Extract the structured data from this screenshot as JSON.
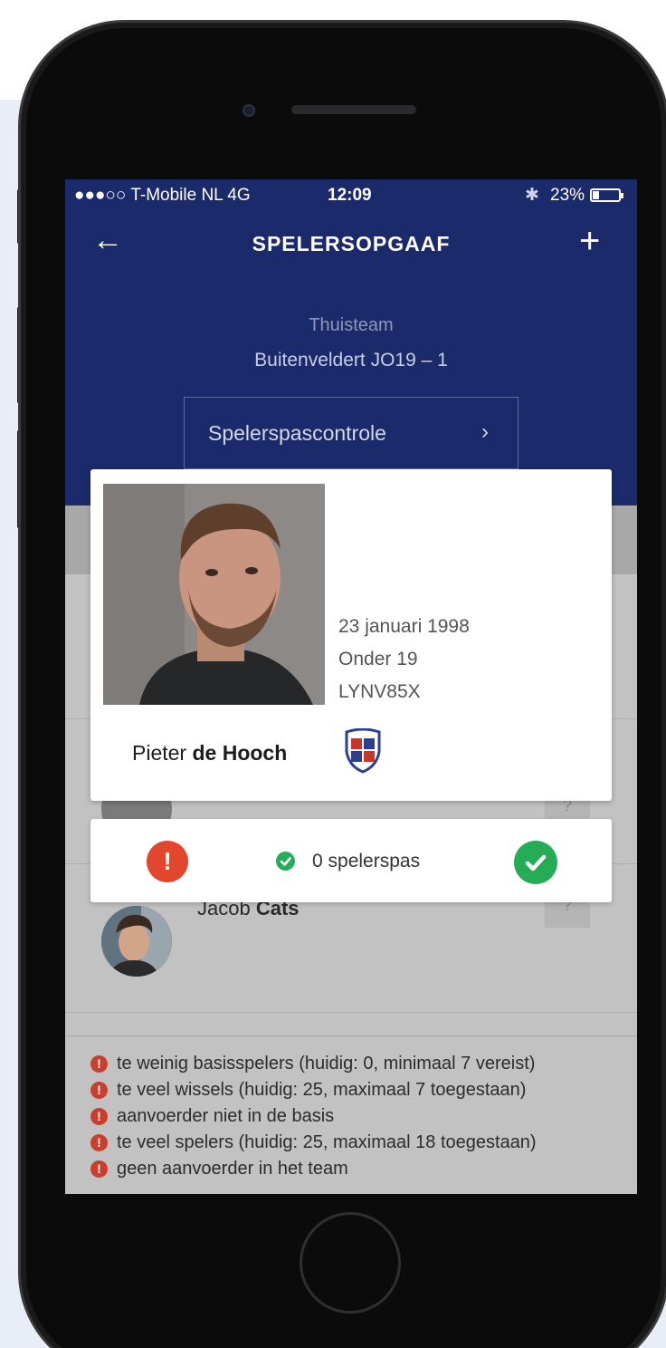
{
  "statusbar": {
    "carrier": "●●●○○ T-Mobile NL  4G",
    "time": "12:09",
    "bluetooth_icon": "bluetooth-icon",
    "battery_percent": "23%",
    "battery_level": 0.23
  },
  "navbar": {
    "back_glyph": "←",
    "title": "SPELERSOPGAAF",
    "add_glyph": "+"
  },
  "header": {
    "team_label": "Thuisteam",
    "team_name": "Buitenveldert JO19 – 1",
    "pass_check_button": "Spelerspascontrole",
    "pass_check_chevron": "›"
  },
  "player_card": {
    "date_of_birth": "23 januari 1998",
    "category": "Onder 19",
    "code": "LYNV85X",
    "first_name": "Pieter ",
    "last_name": "de Hooch",
    "club_logo": "club-crest"
  },
  "pass_status": {
    "warning_glyph": "!",
    "label": "0 spelerspas"
  },
  "players": [
    {
      "first_name": "Jacob ",
      "last_name": "Cats",
      "status": "?"
    }
  ],
  "errors": [
    "te weinig basisspelers (huidig: 0, minimaal 7 vereist)",
    "te veel wissels (huidig: 25, maximaal 7 toegestaan)",
    "aanvoerder niet in de basis",
    "te veel spelers (huidig: 25, maximaal 18 toegestaan)",
    "geen aanvoerder in het team"
  ],
  "colors": {
    "brand_navy": "#1b2a6b",
    "error_red": "#e2462d",
    "success_green": "#24ad55"
  }
}
